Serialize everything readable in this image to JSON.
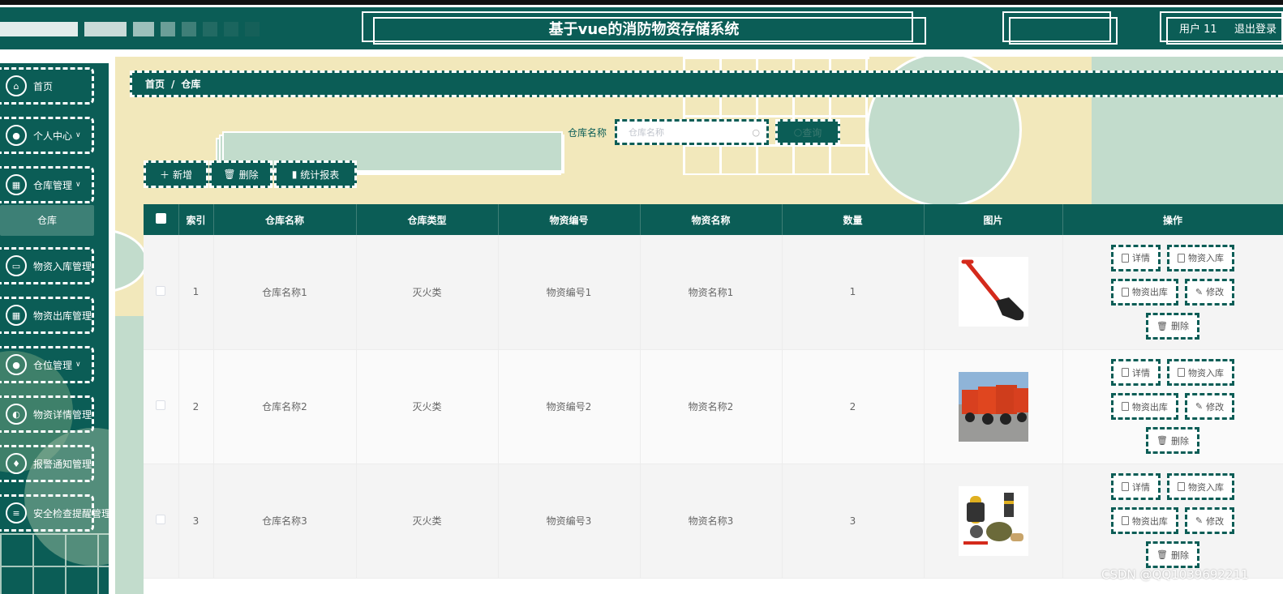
{
  "header": {
    "title": "基于vue的消防物资存储系统",
    "user": "用户 11",
    "logout": "退出登录"
  },
  "sidebar": {
    "items": [
      {
        "label": "首页",
        "icon": "home-icon",
        "has_submenu": false
      },
      {
        "label": "个人中心",
        "icon": "user-icon",
        "has_submenu": true
      },
      {
        "label": "仓库管理",
        "icon": "grid-icon",
        "has_submenu": true
      },
      {
        "label": "物资入库管理",
        "icon": "monitor-icon",
        "has_submenu": false
      },
      {
        "label": "物资出库管理",
        "icon": "grid-icon",
        "has_submenu": false
      },
      {
        "label": "仓位管理",
        "icon": "user-icon",
        "has_submenu": true
      },
      {
        "label": "物资详情管理",
        "icon": "badge-icon",
        "has_submenu": false
      },
      {
        "label": "报警通知管理",
        "icon": "bell-icon",
        "has_submenu": false
      },
      {
        "label": "安全检查提醒管理",
        "icon": "list-icon",
        "has_submenu": false
      }
    ],
    "active_subitem": "仓库"
  },
  "breadcrumb": {
    "home": "首页",
    "separator": "/",
    "current": "仓库"
  },
  "search": {
    "label": "仓库名称",
    "placeholder": "仓库名称",
    "value": "",
    "button": "查询"
  },
  "toolbar": {
    "add": "新增",
    "delete": "删除",
    "report": "统计报表"
  },
  "table": {
    "columns": [
      "索引",
      "仓库名称",
      "仓库类型",
      "物资编号",
      "物资名称",
      "数量",
      "图片",
      "操作"
    ],
    "rows": [
      {
        "index": "1",
        "warehouse": "仓库名称1",
        "type": "灭火类",
        "code": "物资编号1",
        "name": "物资名称1",
        "qty": "1",
        "image": "shovel"
      },
      {
        "index": "2",
        "warehouse": "仓库名称2",
        "type": "灭火类",
        "code": "物资编号2",
        "name": "物资名称2",
        "qty": "2",
        "image": "fire-trucks"
      },
      {
        "index": "3",
        "warehouse": "仓库名称3",
        "type": "灭火类",
        "code": "物资编号3",
        "name": "物资名称3",
        "qty": "3",
        "image": "fire-gear"
      }
    ],
    "actions": {
      "detail": "详情",
      "in": "物资入库",
      "out": "物资出库",
      "edit": "修改",
      "delete": "删除"
    }
  },
  "watermark": "CSDN @QQ1039692211",
  "colors": {
    "primary": "#0b5d56",
    "background": "#f2e8bb",
    "mint": "#c2dccc"
  }
}
